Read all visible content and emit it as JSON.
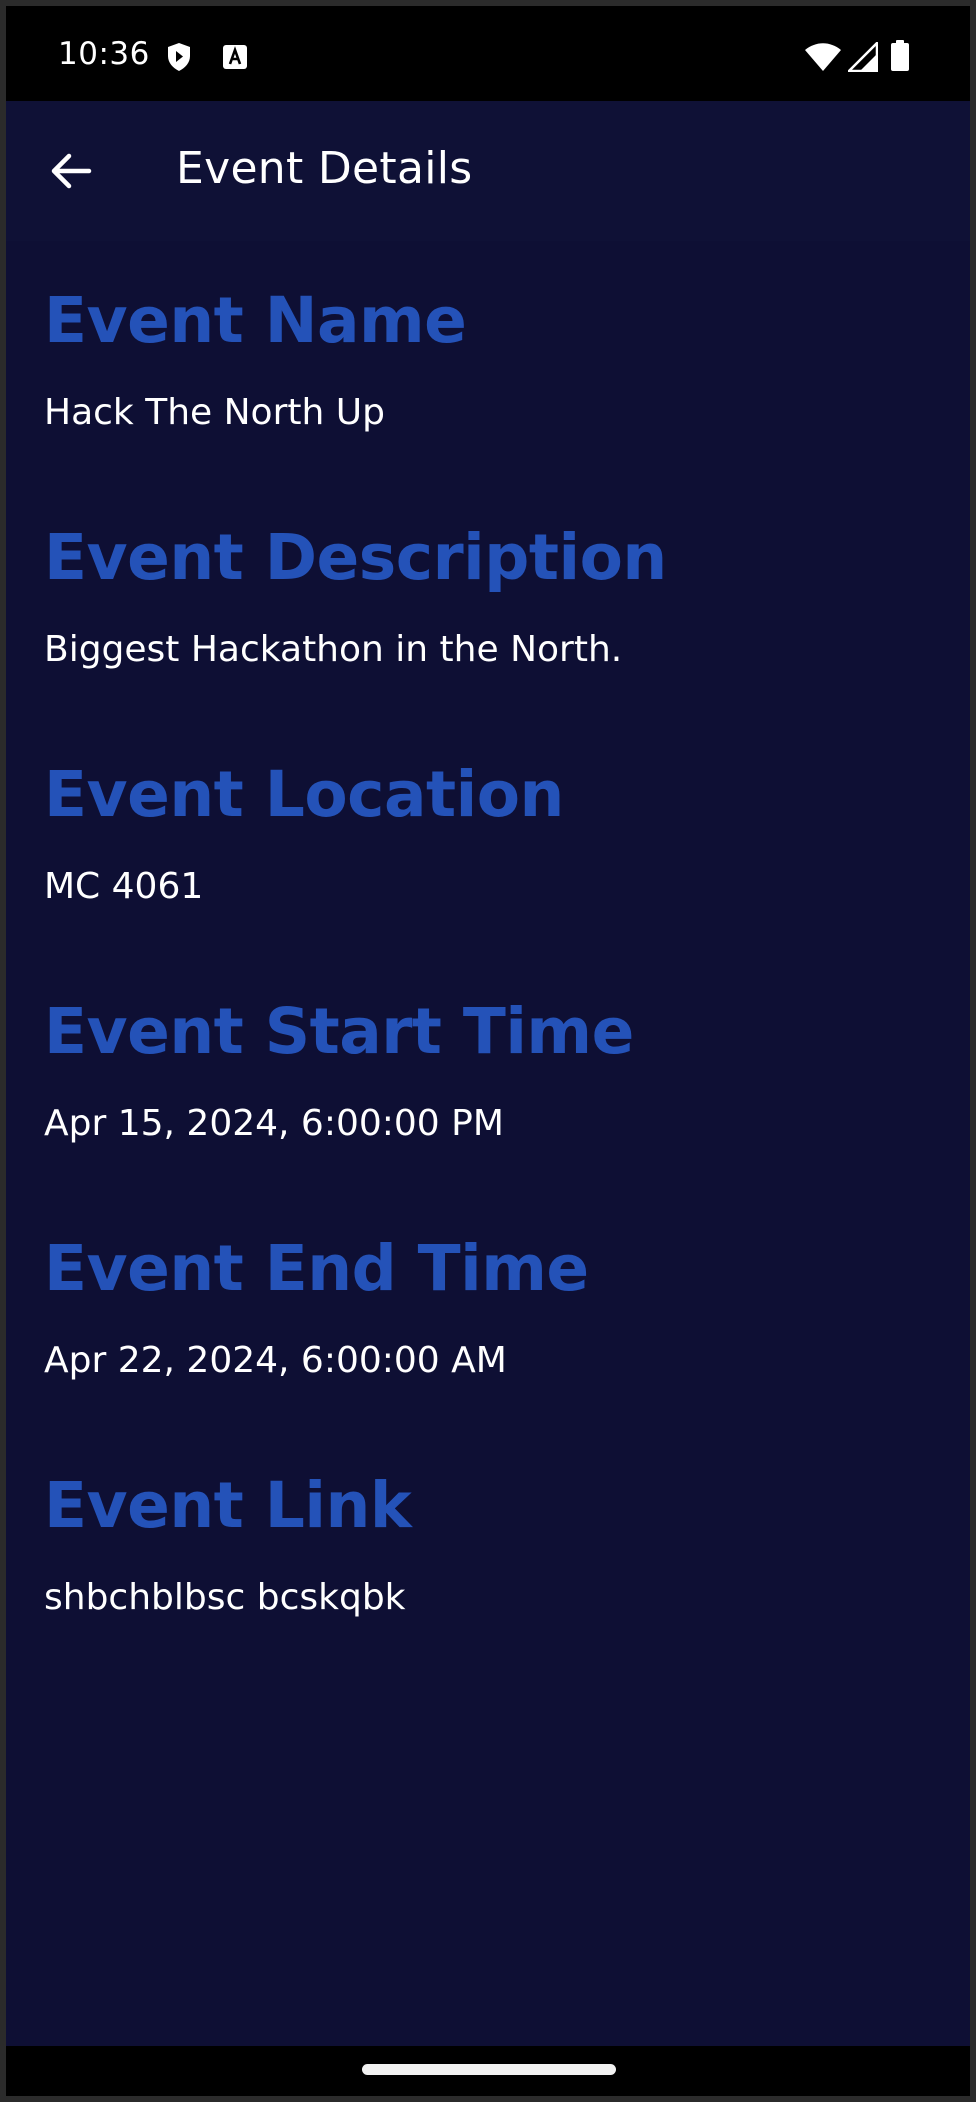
{
  "status_bar": {
    "time": "10:36",
    "left_icons": [
      "shield-icon",
      "text-a-icon"
    ],
    "right_icons": [
      "wifi-icon",
      "cellular-signal-icon",
      "battery-icon"
    ]
  },
  "app_bar": {
    "back_icon": "arrow-left-icon",
    "title": "Event Details"
  },
  "event": {
    "name_label": "Event Name",
    "name_value": "Hack The North Up",
    "description_label": "Event Description",
    "description_value": "Biggest Hackathon in the North.",
    "location_label": "Event Location",
    "location_value": "MC 4061",
    "start_label": "Event Start Time",
    "start_value": "Apr 15, 2024, 6:00:00 PM",
    "end_label": "Event End Time",
    "end_value": "Apr 22, 2024, 6:00:00 AM",
    "link_label": "Event Link",
    "link_value": "shbchblbsc bcskqbk"
  },
  "colors": {
    "background": "#0e0f34",
    "app_bar": "#0f1136",
    "label_accent": "#2452b8",
    "value_text": "#ffffff",
    "status_bar": "#000000"
  }
}
